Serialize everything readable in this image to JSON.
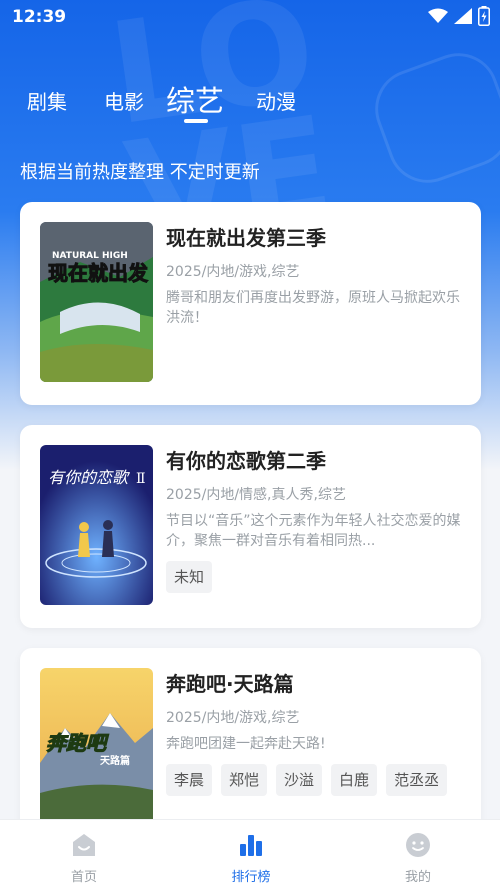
{
  "status": {
    "time": "12:39"
  },
  "tabs": [
    {
      "label": "剧集"
    },
    {
      "label": "电影"
    },
    {
      "label": "综艺",
      "active": true
    },
    {
      "label": "动漫"
    }
  ],
  "subtitle": "根据当前热度整理 不定时更新",
  "cards": [
    {
      "title": "现在就出发第三季",
      "meta": "2025/内地/游戏,综艺",
      "desc": "腾哥和朋友们再度出发野游，原班人马掀起欢乐洪流！",
      "poster_text": "现在就出发",
      "poster_sub": "NATURAL HIGH",
      "tags": []
    },
    {
      "title": "有你的恋歌第二季",
      "meta": "2025/内地/情感,真人秀,综艺",
      "desc": "节目以“音乐”这个元素作为年轻人社交恋爱的媒介，聚焦一群对音乐有着相同热...",
      "poster_text": "有你的恋歌",
      "poster_sub": "Ⅱ",
      "tags": [
        "未知"
      ]
    },
    {
      "title": "奔跑吧·天路篇",
      "meta": "2025/内地/游戏,综艺",
      "desc": "奔跑吧团建一起奔赴天路!",
      "poster_text": "奔跑吧",
      "poster_sub": "天路篇",
      "tags": [
        "李晨",
        "郑恺",
        "沙溢",
        "白鹿",
        "范丞丞"
      ]
    }
  ],
  "nav": [
    {
      "label": "首页",
      "icon": "home-icon"
    },
    {
      "label": "排行榜",
      "icon": "chart-icon",
      "active": true
    },
    {
      "label": "我的",
      "icon": "profile-icon"
    }
  ],
  "colors": {
    "primary": "#1f6fe8",
    "hero_top": "#1565e8"
  }
}
